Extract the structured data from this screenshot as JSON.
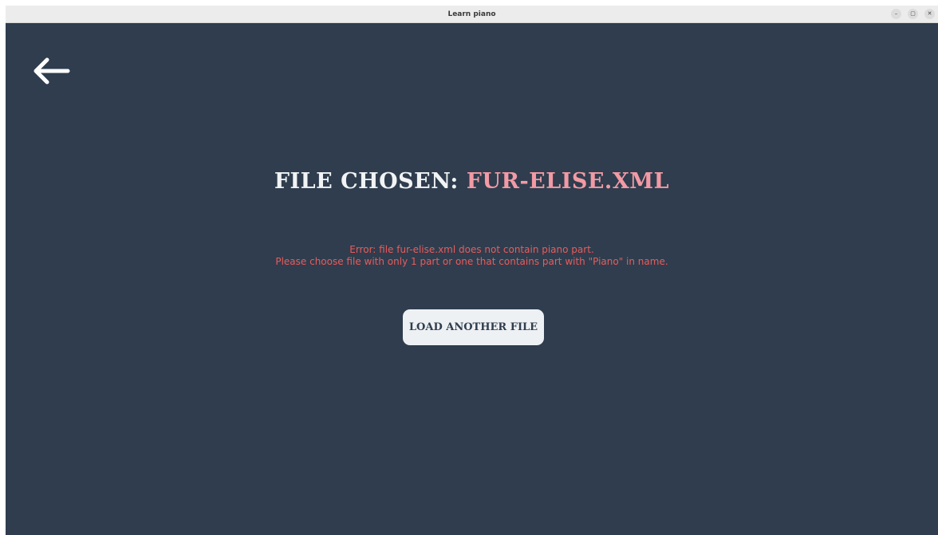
{
  "window": {
    "title": "Learn piano",
    "controls": {
      "minimize": "–",
      "restore": "▢",
      "close": "✕"
    }
  },
  "colors": {
    "background": "#2f3d4e",
    "heading": "#f1f3f5",
    "file_name": "#f29aa5",
    "error": "#e85c5c",
    "button_bg": "#eef1f4"
  },
  "back": {
    "icon": "arrow-left-icon"
  },
  "heading": {
    "prefix": "FILE CHOSEN: ",
    "file_name": "FUR-ELISE.XML"
  },
  "error": {
    "line1": "Error: file fur-elise.xml does not contain piano part.",
    "line2": "Please choose file with only 1 part or one that contains part with \"Piano\" in name."
  },
  "load_button": {
    "label": "LOAD ANOTHER FILE"
  }
}
